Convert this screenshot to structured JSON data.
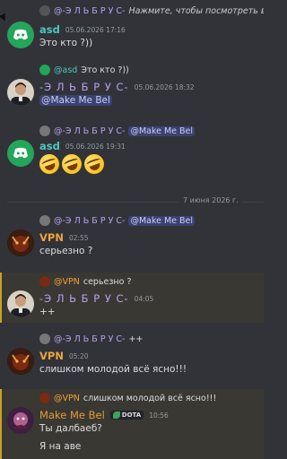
{
  "messages": [
    {
      "reply_name": "@-Э Л Ь Б Р У С-",
      "reply_text": "Нажмите, чтобы посмотреть вложение",
      "name": "asd",
      "time": "05.06.2026 17:16",
      "text": "Это кто ?))"
    },
    {
      "reply_name": "@asd",
      "reply_text": "Это кто ?))",
      "name": "-Э Л Ь Б Р У С-",
      "time": "05.06.2026 18:32",
      "text": "@Make Me Bel"
    },
    {
      "reply_name": "@-Э Л Ь Б Р У С-",
      "reply_mention": "@Make Me Bel",
      "name": "asd",
      "time": "05.06.2026 19:31",
      "emoji_count": 3
    },
    {
      "reply_name": "@-Э Л Ь Б Р У С-",
      "reply_mention": "@Make Me Bel",
      "name": "VPN",
      "time": "02:55",
      "text": "серьезно ?"
    },
    {
      "reply_name": "@VPN",
      "reply_text": "серьезно ?",
      "name": "-Э Л Ь Б Р У С-",
      "time": "04:05",
      "text": "++"
    },
    {
      "reply_name": "@-Э Л Ь Б Р У С-",
      "reply_text": "++",
      "name": "VPN",
      "time": "05:20",
      "text": "слишком молодой всё ясно!!!"
    },
    {
      "reply_name": "@VPN",
      "reply_text": "слишком молодой всё ясно!!!",
      "name": "Make Me Bel",
      "badge": "DOTA",
      "time": "10:56",
      "text": "Ты далбаеб?",
      "text2": "Я на аве"
    }
  ],
  "divider": "7 июня 2026 г.",
  "icons": {
    "discord": "discord-logo-icon",
    "cursor": "mouse-cursor-icon",
    "badge": "leaf-icon"
  }
}
